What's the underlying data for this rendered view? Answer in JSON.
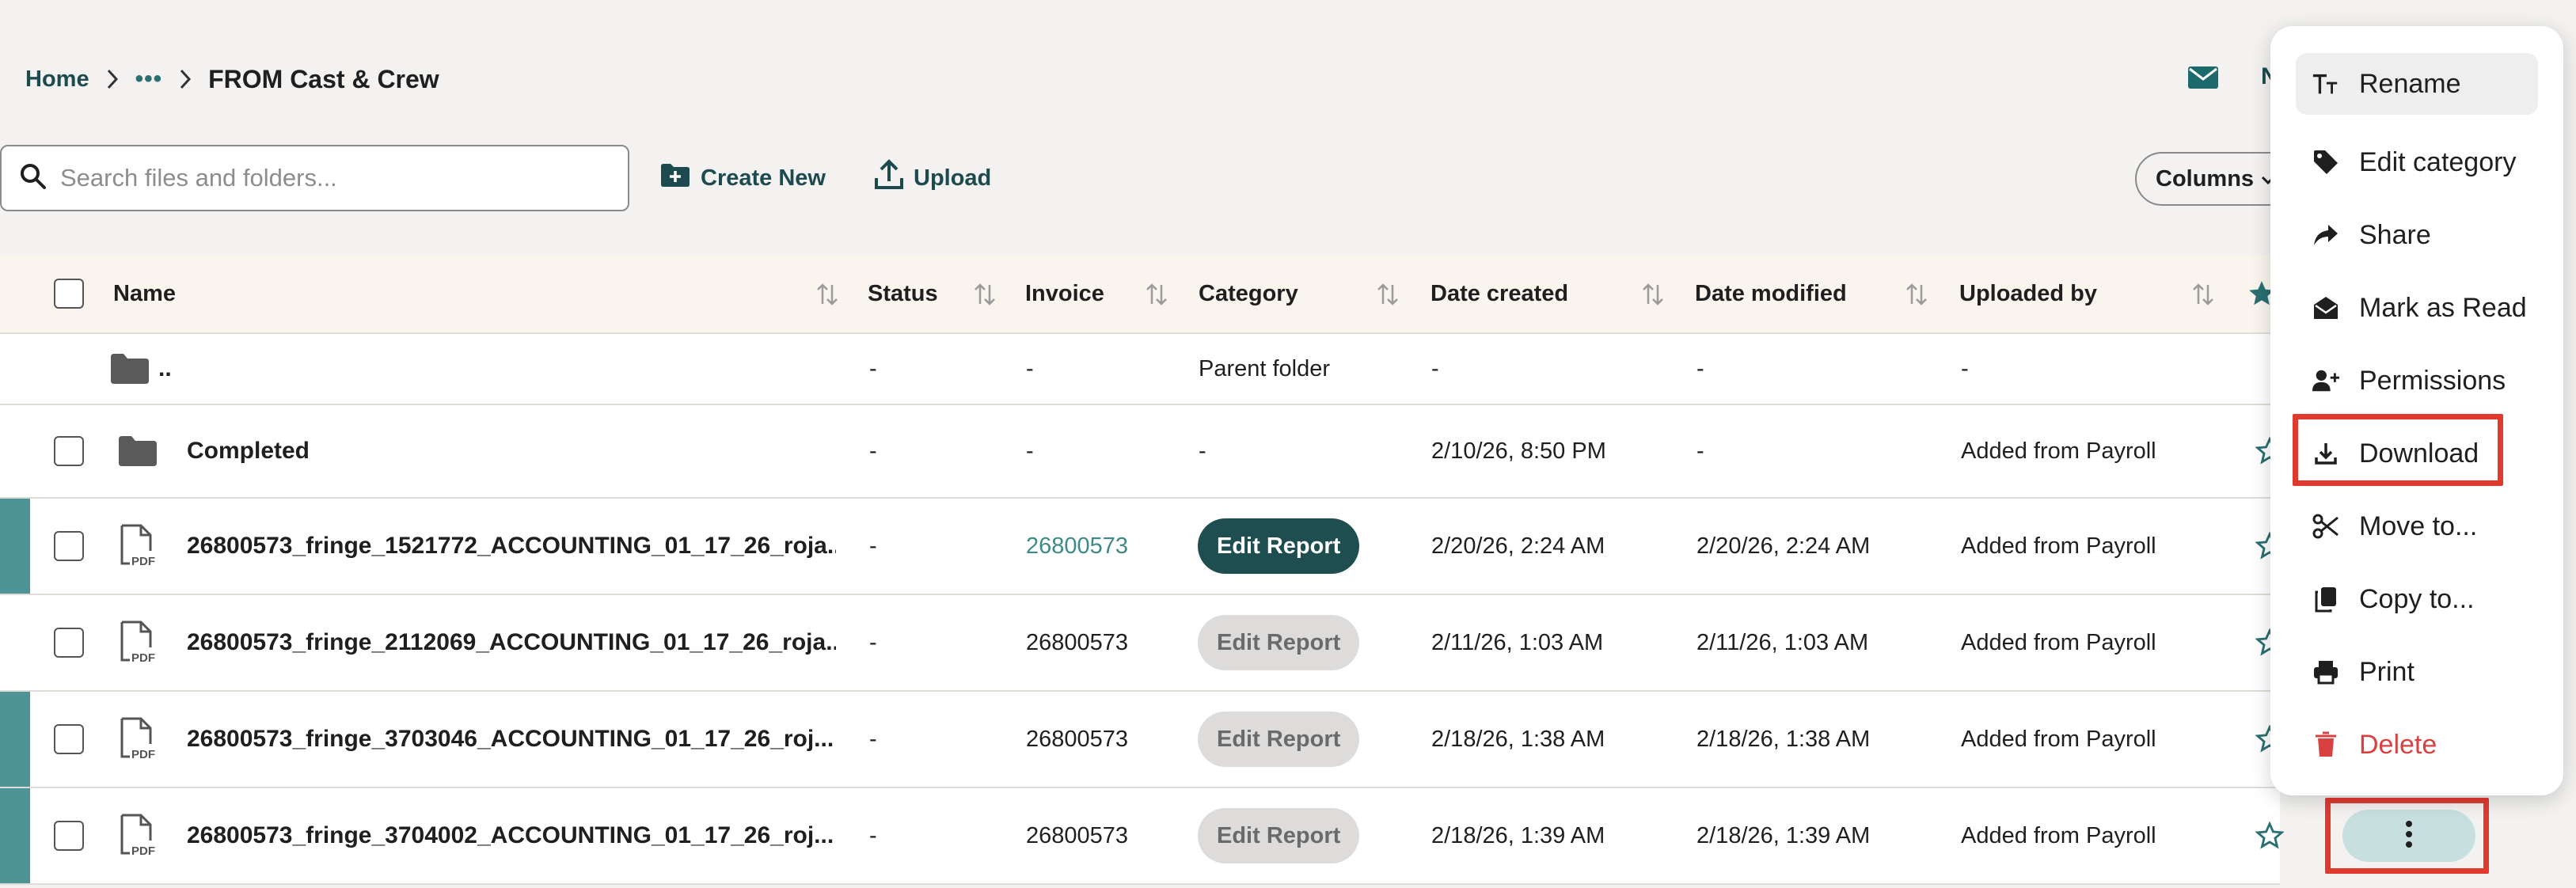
{
  "breadcrumb": {
    "home": "Home",
    "more": "•••",
    "current": "FROM Cast & Crew"
  },
  "header": {
    "partial_label": "N"
  },
  "toolbar": {
    "search_placeholder": "Search files and folders...",
    "create_new": "Create New",
    "upload": "Upload",
    "columns": "Columns"
  },
  "table": {
    "columns": {
      "name": "Name",
      "status": "Status",
      "invoice": "Invoice",
      "category": "Category",
      "date_created": "Date created",
      "date_modified": "Date modified",
      "uploaded_by": "Uploaded by"
    },
    "parent_row": {
      "name": "..",
      "status": "-",
      "invoice": "-",
      "category": "Parent folder",
      "date_created": "-",
      "date_modified": "-",
      "uploaded_by": "-"
    },
    "folder_row": {
      "name": "Completed",
      "status": "-",
      "invoice": "-",
      "category": "-",
      "date_created": "2/10/26, 8:50 PM",
      "date_modified": "-",
      "uploaded_by": "Added from Payroll"
    },
    "file_rows": [
      {
        "name": "26800573_fringe_1521772_ACCOUNTING_01_17_26_roja...",
        "status": "-",
        "invoice": "26800573",
        "category": "Edit Report",
        "date_created": "2/20/26, 2:24 AM",
        "date_modified": "2/20/26, 2:24 AM",
        "uploaded_by": "Added from Payroll"
      },
      {
        "name": "26800573_fringe_2112069_ACCOUNTING_01_17_26_roja...",
        "status": "-",
        "invoice": "26800573",
        "category": "Edit Report",
        "date_created": "2/11/26, 1:03 AM",
        "date_modified": "2/11/26, 1:03 AM",
        "uploaded_by": "Added from Payroll"
      },
      {
        "name": "26800573_fringe_3703046_ACCOUNTING_01_17_26_roj...",
        "status": "-",
        "invoice": "26800573",
        "category": "Edit Report",
        "date_created": "2/18/26, 1:38 AM",
        "date_modified": "2/18/26, 1:38 AM",
        "uploaded_by": "Added from Payroll"
      },
      {
        "name": "26800573_fringe_3704002_ACCOUNTING_01_17_26_roj...",
        "status": "-",
        "invoice": "26800573",
        "category": "Edit Report",
        "date_created": "2/18/26, 1:39 AM",
        "date_modified": "2/18/26, 1:39 AM",
        "uploaded_by": "Added from Payroll"
      }
    ]
  },
  "context_menu": {
    "items": [
      {
        "label": "Rename",
        "icon": "text-format-icon"
      },
      {
        "label": "Edit category",
        "icon": "tag-icon"
      },
      {
        "label": "Share",
        "icon": "share-arrow-icon"
      },
      {
        "label": "Mark as Read",
        "icon": "envelope-open-icon"
      },
      {
        "label": "Permissions",
        "icon": "user-plus-icon"
      },
      {
        "label": "Download",
        "icon": "download-icon"
      },
      {
        "label": "Move to...",
        "icon": "scissors-icon"
      },
      {
        "label": "Copy to...",
        "icon": "copy-icon"
      },
      {
        "label": "Print",
        "icon": "printer-icon"
      },
      {
        "label": "Delete",
        "icon": "trash-icon"
      }
    ]
  },
  "colors": {
    "brand_dark": "#1d4a4e",
    "accent_teal": "#4f9495",
    "danger": "#d94040",
    "highlight": "#e03a2f"
  }
}
